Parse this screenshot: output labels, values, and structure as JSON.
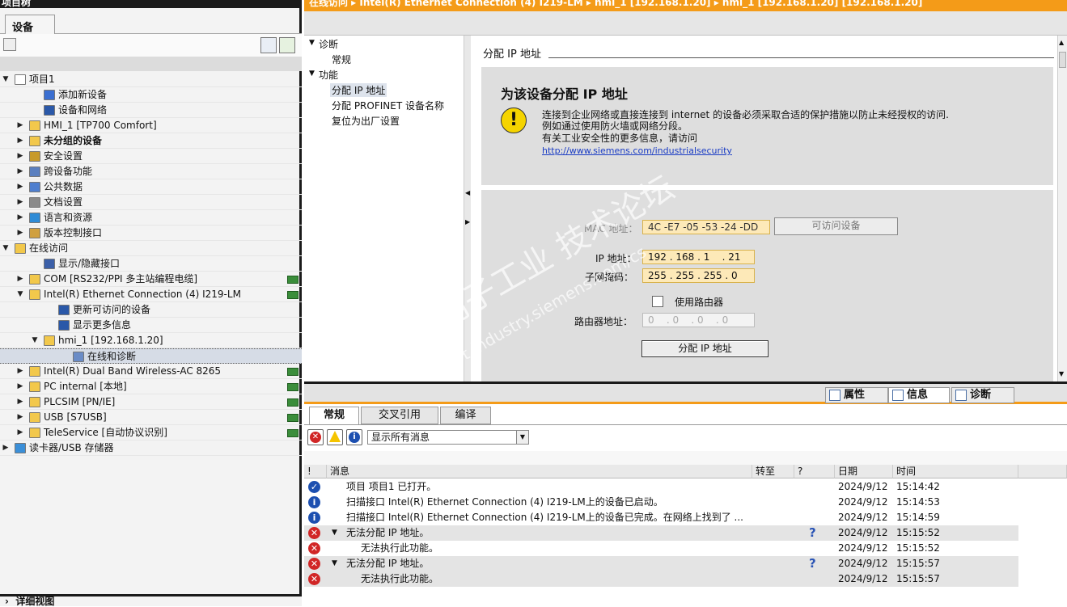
{
  "left_panel": {
    "title": "项目树",
    "tab": "设备",
    "tree": [
      {
        "label": "项目1",
        "indent": 0,
        "arrow": "▼",
        "icon": "project-icon",
        "status": false
      },
      {
        "label": "添加新设备",
        "indent": 2,
        "arrow": "",
        "icon": "add-device-icon",
        "status": false
      },
      {
        "label": "设备和网络",
        "indent": 2,
        "arrow": "",
        "icon": "network-icon",
        "status": false
      },
      {
        "label": "HMI_1 [TP700 Comfort]",
        "indent": 1,
        "arrow": "▶",
        "icon": "hmi-folder-icon",
        "status": false
      },
      {
        "label": "未分组的设备",
        "indent": 1,
        "arrow": "▶",
        "icon": "folder-icon",
        "status": false,
        "bold": true
      },
      {
        "label": "安全设置",
        "indent": 1,
        "arrow": "▶",
        "icon": "security-icon",
        "status": false
      },
      {
        "label": "跨设备功能",
        "indent": 1,
        "arrow": "▶",
        "icon": "cross-device-icon",
        "status": false
      },
      {
        "label": "公共数据",
        "indent": 1,
        "arrow": "▶",
        "icon": "common-data-icon",
        "status": false
      },
      {
        "label": "文档设置",
        "indent": 1,
        "arrow": "▶",
        "icon": "document-icon",
        "status": false
      },
      {
        "label": "语言和资源",
        "indent": 1,
        "arrow": "▶",
        "icon": "language-icon",
        "status": false
      },
      {
        "label": "版本控制接口",
        "indent": 1,
        "arrow": "▶",
        "icon": "version-icon",
        "status": false
      },
      {
        "label": "在线访问",
        "indent": 0,
        "arrow": "▼",
        "icon": "online-icon",
        "status": false
      },
      {
        "label": "显示/隐藏接口",
        "indent": 2,
        "arrow": "",
        "icon": "wrench-icon",
        "status": false
      },
      {
        "label": "COM [RS232/PPI 多主站编程电缆]",
        "indent": 1,
        "arrow": "▶",
        "icon": "folder-icon",
        "status": true
      },
      {
        "label": "Intel(R) Ethernet Connection (4) I219-LM",
        "indent": 1,
        "arrow": "▼",
        "icon": "folder-icon",
        "status": true
      },
      {
        "label": "更新可访问的设备",
        "indent": 3,
        "arrow": "",
        "icon": "update-icon",
        "status": false
      },
      {
        "label": "显示更多信息",
        "indent": 3,
        "arrow": "",
        "icon": "info-more-icon",
        "status": false
      },
      {
        "label": "hmi_1 [192.168.1.20]",
        "indent": 2,
        "arrow": "▼",
        "icon": "folder-icon",
        "status": false
      },
      {
        "label": "在线和诊断",
        "indent": 4,
        "arrow": "",
        "icon": "diagnostics-icon",
        "status": false,
        "selected": true
      },
      {
        "label": "Intel(R) Dual Band Wireless-AC 8265",
        "indent": 1,
        "arrow": "▶",
        "icon": "folder-icon",
        "status": true
      },
      {
        "label": "PC internal [本地]",
        "indent": 1,
        "arrow": "▶",
        "icon": "folder-icon",
        "status": true
      },
      {
        "label": "PLCSIM [PN/IE]",
        "indent": 1,
        "arrow": "▶",
        "icon": "folder-icon",
        "status": true
      },
      {
        "label": "USB [S7USB]",
        "indent": 1,
        "arrow": "▶",
        "icon": "folder-icon",
        "status": true
      },
      {
        "label": "TeleService [自动协议识别]",
        "indent": 1,
        "arrow": "▶",
        "icon": "folder-icon",
        "status": true
      },
      {
        "label": "读卡器/USB 存储器",
        "indent": 0,
        "arrow": "▶",
        "icon": "card-reader-icon",
        "status": false
      }
    ],
    "detail_view": "详细视图"
  },
  "topbar": {
    "breadcrumb": "在线访问  ▸  Intel(R) Ethernet Connection (4) I219-LM  ▸  hmi_1 [192.168.1.20]  ▸  hmi_1 [192.168.1.20] [192.168.1.20]"
  },
  "nav": {
    "diag": "诊断",
    "general": "常规",
    "func": "功能",
    "assign_ip": "分配 IP 地址",
    "assign_profinet": "分配 PROFINET 设备名称",
    "reset": "复位为出厂设置"
  },
  "content": {
    "section_title": "分配 IP 地址",
    "heading": "为该设备分配 IP 地址",
    "warn_line1": "连接到企业网络或直接连接到 internet 的设备必须采取合适的保护措施以防止未经授权的访问.",
    "warn_line2": "例如通过使用防火墙或网络分段。",
    "warn_line3": "有关工业安全性的更多信息，请访问",
    "warn_link": "http://www.siemens.com/industrialsecurity",
    "mac_label": "MAC 地址：",
    "mac_value": "4C -E7 -05 -53 -24 -DD",
    "accessible_btn": "可访问设备",
    "ip_label": "IP 地址：",
    "ip_value": "192 . 168 . 1    . 21",
    "subnet_label": "子网掩码：",
    "subnet_value": "255 . 255 . 255 . 0",
    "use_router": "使用路由器",
    "router_label": "路由器地址：",
    "router_value": "0    . 0    . 0    . 0",
    "assign_btn": "分配 IP 地址"
  },
  "inspector_tabs": {
    "props": "属性",
    "info": "信息",
    "diag": "诊断"
  },
  "lower": {
    "tabs": [
      "常规",
      "交叉引用",
      "编译"
    ],
    "filter": "显示所有消息",
    "headers": {
      "bang": "!",
      "msg": "消息",
      "goto": "转至",
      "q": "?",
      "date": "日期",
      "time": "时间"
    },
    "rows": [
      {
        "type": "ok",
        "text": "项目 项目1 已打开。",
        "date": "2024/9/12",
        "time": "15:14:42",
        "indent": 0,
        "q": false,
        "gray": false
      },
      {
        "type": "inf",
        "text": "扫描接口 Intel(R) Ethernet Connection (4) I219-LM上的设备已启动。",
        "date": "2024/9/12",
        "time": "15:14:53",
        "indent": 0,
        "q": false,
        "gray": false
      },
      {
        "type": "inf",
        "text": "扫描接口 Intel(R) Ethernet Connection (4) I219-LM上的设备已完成。在网络上找到了 ...",
        "date": "2024/9/12",
        "time": "15:14:59",
        "indent": 0,
        "q": false,
        "gray": false
      },
      {
        "type": "err",
        "text": "无法分配 IP 地址。",
        "date": "2024/9/12",
        "time": "15:15:52",
        "indent": 1,
        "q": true,
        "gray": true
      },
      {
        "type": "err",
        "text": "无法执行此功能。",
        "date": "2024/9/12",
        "time": "15:15:52",
        "indent": 2,
        "q": false,
        "gray": false
      },
      {
        "type": "err",
        "text": "无法分配 IP 地址。",
        "date": "2024/9/12",
        "time": "15:15:57",
        "indent": 1,
        "q": true,
        "gray": true
      },
      {
        "type": "err",
        "text": "无法执行此功能。",
        "date": "2024/9/12",
        "time": "15:15:57",
        "indent": 2,
        "q": false,
        "gray": true
      }
    ]
  },
  "watermark": {
    "line1": "西门子工业 技术论坛",
    "line2": "support.industry.siemens.com/cs"
  },
  "colors": {
    "accent": "#f49b18",
    "error": "#d12626",
    "info": "#1c4fb0"
  }
}
